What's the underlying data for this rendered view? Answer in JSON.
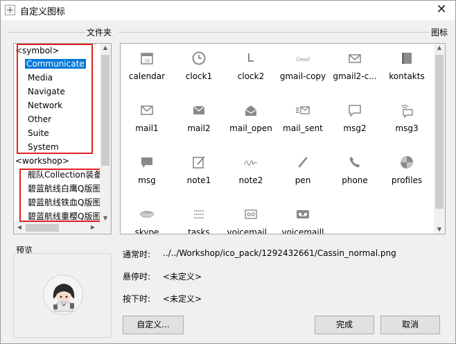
{
  "window": {
    "title": "自定义图标",
    "close_glyph": "✕"
  },
  "folders": {
    "label": "文件夹",
    "groups": [
      {
        "label": "<symbol>",
        "items": [
          "Communicate",
          "Media",
          "Navigate",
          "Network",
          "Other",
          "Suite",
          "System"
        ],
        "selected": "Communicate"
      },
      {
        "label": "<workshop>",
        "items": [
          "舰队Collection装备",
          "碧蓝航线白鹰Q版图",
          "碧蓝航线铁血Q版图",
          "碧蓝航线重樱Q版图"
        ]
      }
    ]
  },
  "icons": {
    "label": "图标",
    "items": [
      {
        "name": "calendar",
        "icon": "calendar-icon"
      },
      {
        "name": "clock1",
        "icon": "clock-icon"
      },
      {
        "name": "clock2",
        "icon": "clock-hands-icon"
      },
      {
        "name": "gmail-copy",
        "icon": "gmail-text-icon"
      },
      {
        "name": "gmail2-c...",
        "icon": "gmail-envelope-icon"
      },
      {
        "name": "kontakts",
        "icon": "contacts-book-icon"
      },
      {
        "name": "mail1",
        "icon": "mail-envelope-icon"
      },
      {
        "name": "mail2",
        "icon": "mail-filled-icon"
      },
      {
        "name": "mail_open",
        "icon": "mail-open-icon"
      },
      {
        "name": "mail_sent",
        "icon": "mail-sent-icon"
      },
      {
        "name": "msg2",
        "icon": "speech-bubble-outline-icon"
      },
      {
        "name": "msg3",
        "icon": "message-wifi-icon"
      },
      {
        "name": "msg",
        "icon": "speech-bubble-filled-icon"
      },
      {
        "name": "note1",
        "icon": "note-edit-icon"
      },
      {
        "name": "note2",
        "icon": "signature-icon"
      },
      {
        "name": "pen",
        "icon": "pen-icon"
      },
      {
        "name": "phone",
        "icon": "phone-icon"
      },
      {
        "name": "profiles",
        "icon": "profiles-pinwheel-icon"
      },
      {
        "name": "skype",
        "icon": "skype-icon"
      },
      {
        "name": "tasks",
        "icon": "tasks-list-icon"
      },
      {
        "name": "voicemail...",
        "icon": "voicemail-envelope-icon"
      },
      {
        "name": "voicemaill",
        "icon": "voicemail-tape-icon"
      }
    ]
  },
  "preview": {
    "label": "预览"
  },
  "states": {
    "normal_label": "通常时:",
    "normal_value": "../../Workshop/ico_pack/1292432661/Cassin_normal.png",
    "hover_label": "悬停时:",
    "hover_value": "<未定义>",
    "press_label": "按下时:",
    "press_value": "<未定义>"
  },
  "buttons": {
    "custom": "自定义...",
    "ok": "完成",
    "cancel": "取消"
  },
  "colors": {
    "selection": "#0078d7",
    "highlight_box": "#e02020",
    "icon_gray": "#8a8a8a"
  }
}
